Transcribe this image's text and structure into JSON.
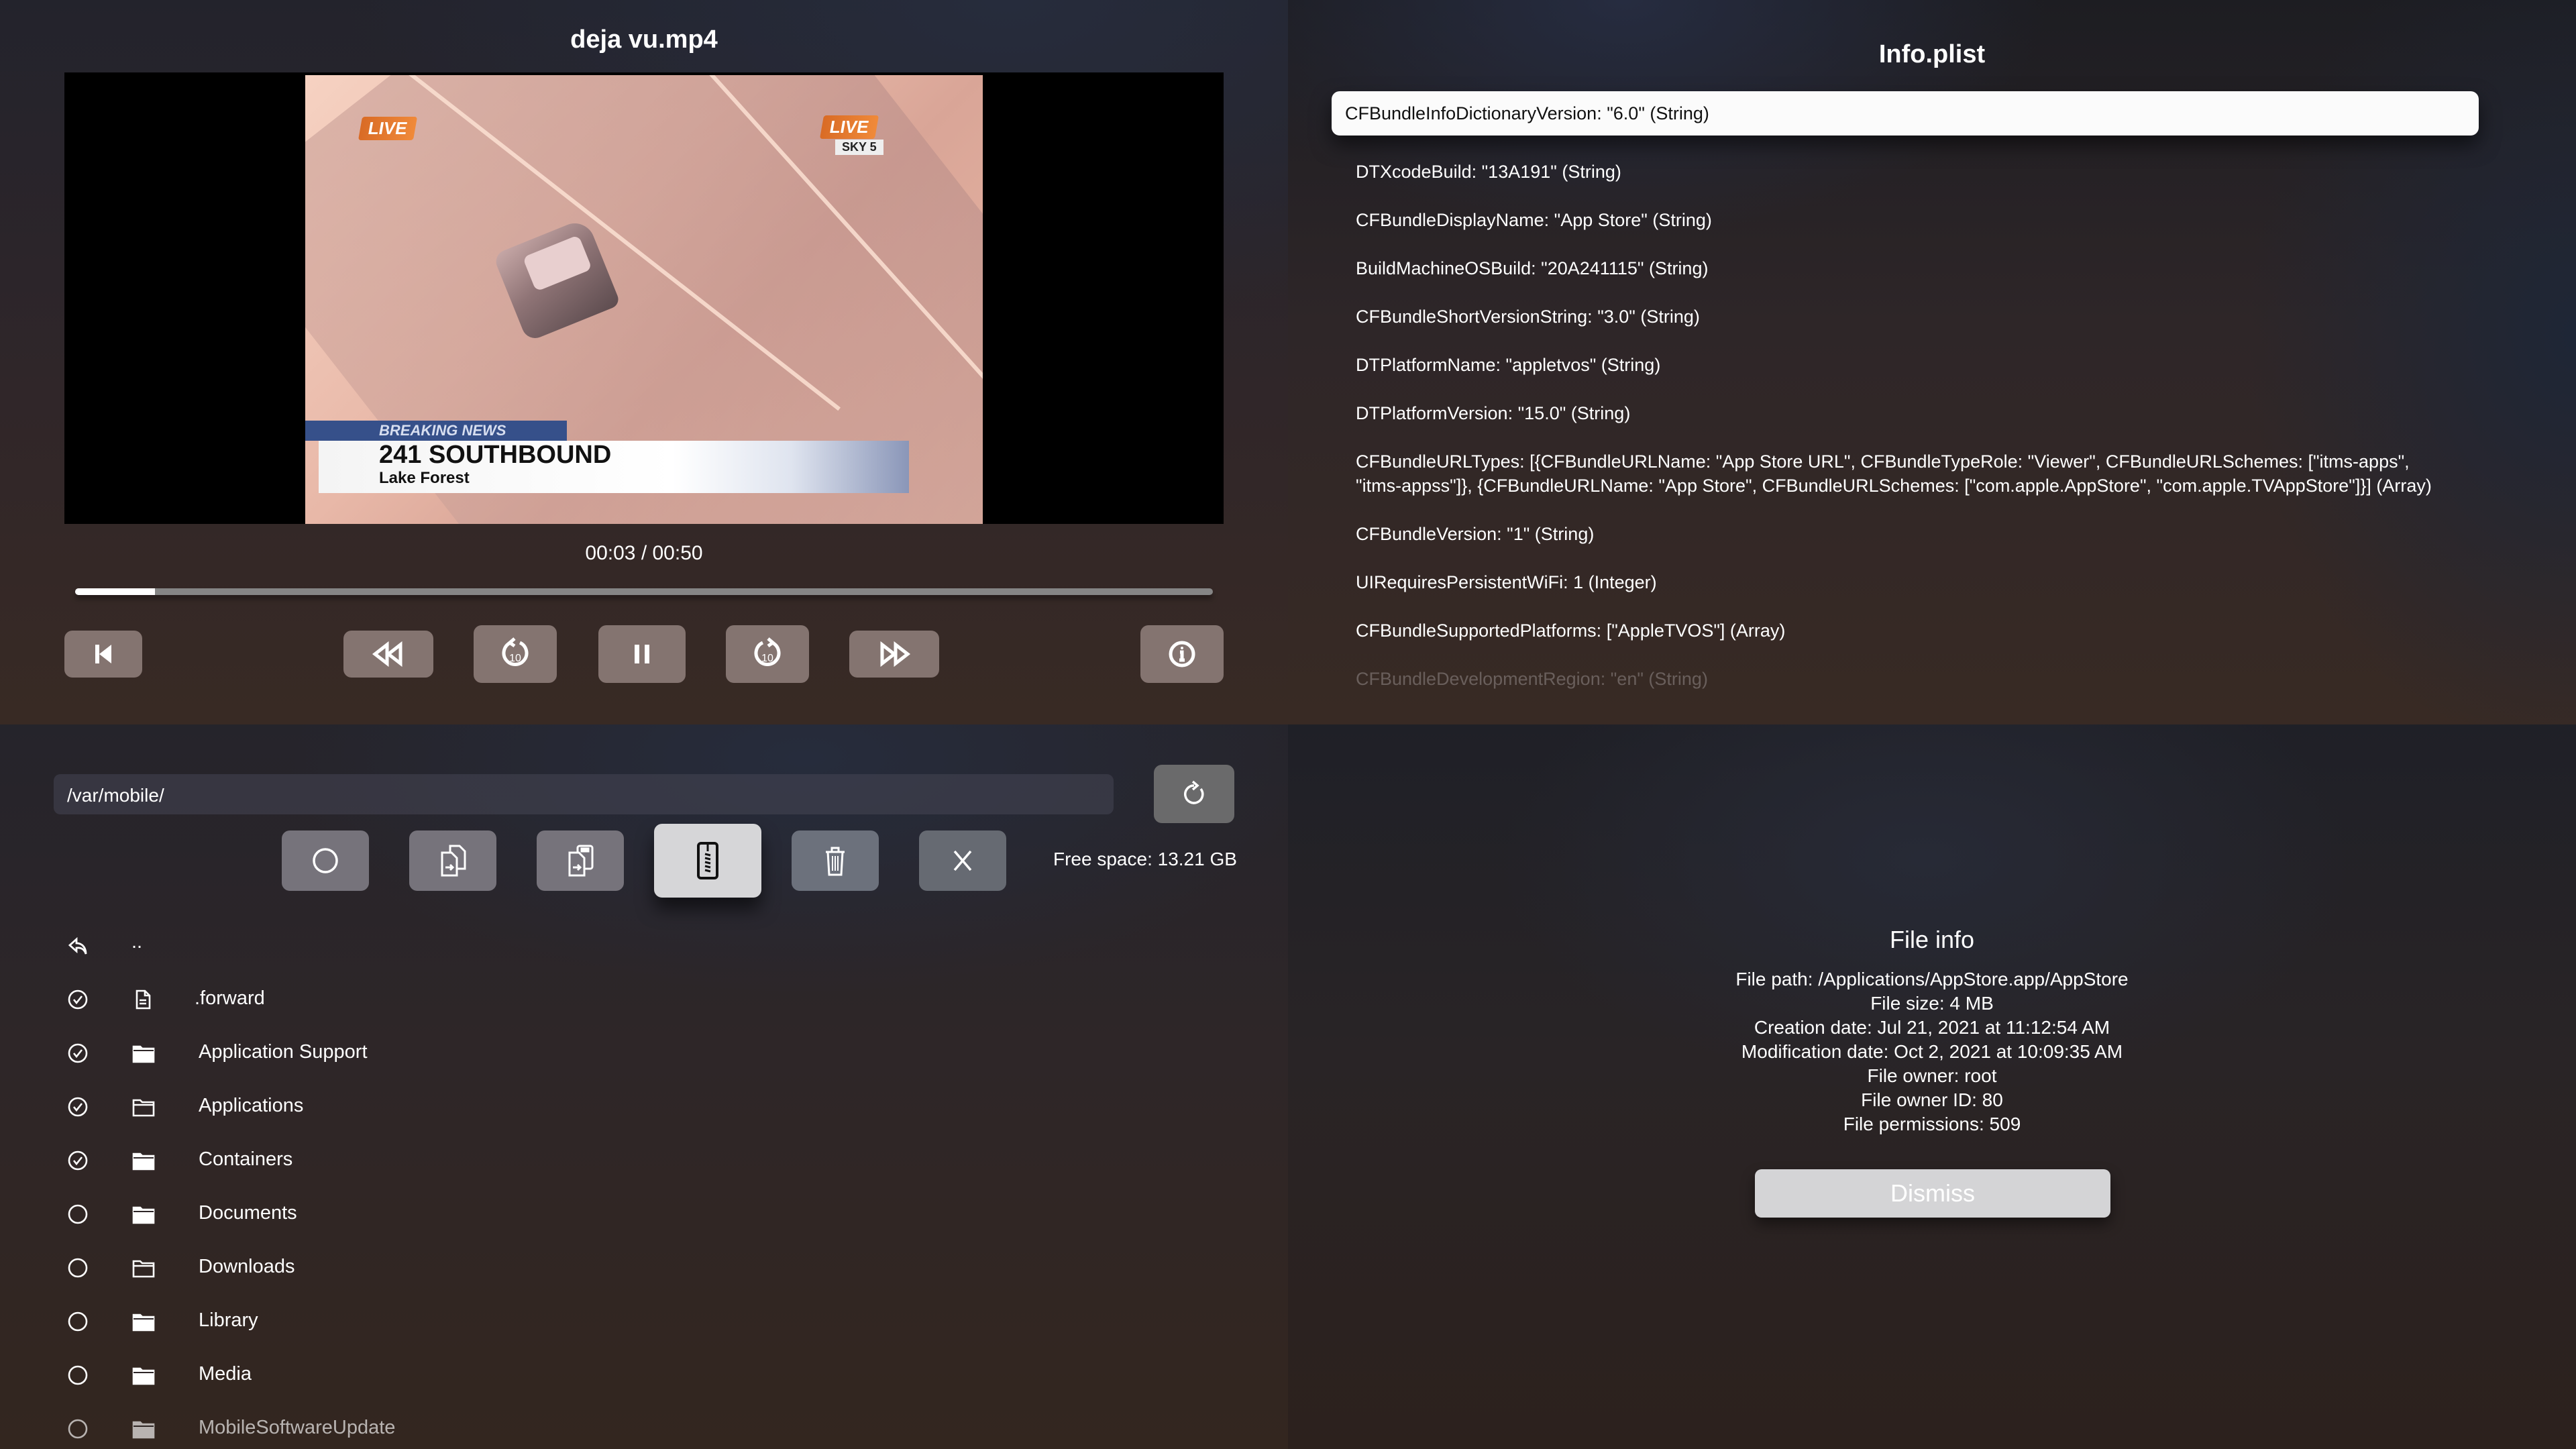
{
  "player": {
    "title": "deja vu.mp4",
    "time_label": "00:03 / 00:50",
    "progress_fraction": 0.07,
    "video_overlay": {
      "live_left": "LIVE",
      "live_right": "LIVE",
      "channel": "SKY 5",
      "banner_tag": "BREAKING NEWS",
      "headline": "241 SOUTHBOUND",
      "subline": "Lake Forest"
    },
    "controls": [
      {
        "name": "previous-track-button",
        "icon": "skip-back-icon"
      },
      {
        "name": "rewind-button",
        "icon": "rewind-icon"
      },
      {
        "name": "skip-back-10-button",
        "icon": "rotate-back-10-icon"
      },
      {
        "name": "pause-button",
        "icon": "pause-icon"
      },
      {
        "name": "skip-forward-10-button",
        "icon": "rotate-forward-10-icon"
      },
      {
        "name": "fast-forward-button",
        "icon": "fast-forward-icon"
      },
      {
        "name": "info-button",
        "icon": "info-icon"
      }
    ],
    "skip_seconds": "10"
  },
  "plist": {
    "title": "Info.plist",
    "rows": [
      "CFBundleInfoDictionaryVersion: \"6.0\" (String)",
      "DTXcodeBuild: \"13A191\" (String)",
      "CFBundleDisplayName: \"App Store\" (String)",
      "BuildMachineOSBuild: \"20A241115\" (String)",
      "CFBundleShortVersionString: \"3.0\" (String)",
      "DTPlatformName: \"appletvos\" (String)",
      "DTPlatformVersion: \"15.0\" (String)",
      "CFBundleURLTypes: [{CFBundleURLName: \"App Store URL\", CFBundleTypeRole: \"Viewer\", CFBundleURLSchemes: [\"itms-apps\", \"itms-appss\"]}, {CFBundleURLName: \"App Store\", CFBundleURLSchemes: [\"com.apple.AppStore\", \"com.apple.TVAppStore\"]}] (Array)",
      "CFBundleVersion: \"1\" (String)",
      "UIRequiresPersistentWiFi: 1 (Integer)",
      "CFBundleSupportedPlatforms: [\"AppleTVOS\"] (Array)",
      "CFBundleDevelopmentRegion: \"en\" (String)"
    ],
    "selected_index": 0
  },
  "browser": {
    "path_value": "/var/mobile/",
    "free_space": "Free space: 13.21 GB",
    "toolbar": [
      {
        "name": "select-all-button",
        "icon": "circle-icon"
      },
      {
        "name": "copy-button",
        "icon": "copy-files-icon"
      },
      {
        "name": "move-button",
        "icon": "move-files-icon"
      },
      {
        "name": "compress-button",
        "icon": "zip-archive-icon",
        "focused": true
      },
      {
        "name": "delete-button",
        "icon": "trash-icon"
      },
      {
        "name": "cancel-button",
        "icon": "close-icon"
      }
    ],
    "parent_label": "..",
    "items": [
      {
        "name": ".forward",
        "type": "file",
        "selected": true
      },
      {
        "name": "Application Support",
        "type": "folder-filled",
        "selected": true
      },
      {
        "name": "Applications",
        "type": "folder-outline",
        "selected": true
      },
      {
        "name": "Containers",
        "type": "folder-filled",
        "selected": true
      },
      {
        "name": "Documents",
        "type": "folder-filled",
        "selected": false
      },
      {
        "name": "Downloads",
        "type": "folder-outline",
        "selected": false
      },
      {
        "name": "Library",
        "type": "folder-filled",
        "selected": false
      },
      {
        "name": "Media",
        "type": "folder-filled",
        "selected": false
      },
      {
        "name": "MobileSoftwareUpdate",
        "type": "folder-filled",
        "selected": false
      }
    ]
  },
  "file_info": {
    "title": "File info",
    "lines": [
      "File path: /Applications/AppStore.app/AppStore",
      "File size: 4 MB",
      "Creation date: Jul 21, 2021 at 11:12:54 AM",
      "Modification date: Oct 2, 2021 at 10:09:35 AM",
      "File owner: root",
      "File owner ID: 80",
      "File permissions: 509"
    ],
    "dismiss_label": "Dismiss"
  }
}
